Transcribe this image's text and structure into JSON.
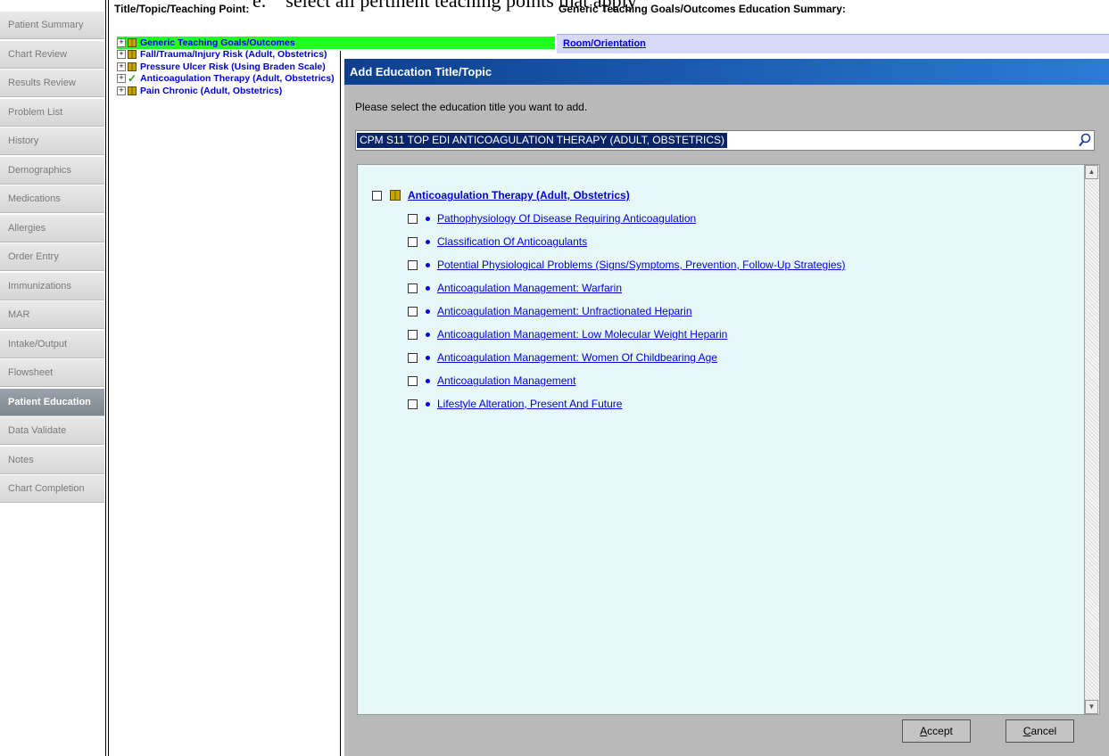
{
  "caption": {
    "marker": "e.",
    "text": "select all pertinent teaching points that apply"
  },
  "nav": {
    "items": [
      {
        "label": "Patient Summary",
        "active": false
      },
      {
        "label": "Chart Review",
        "active": false
      },
      {
        "label": "Results Review",
        "active": false
      },
      {
        "label": "Problem List",
        "active": false
      },
      {
        "label": "History",
        "active": false
      },
      {
        "label": "Demographics",
        "active": false
      },
      {
        "label": "Medications",
        "active": false
      },
      {
        "label": "Allergies",
        "active": false
      },
      {
        "label": "Order Entry",
        "active": false
      },
      {
        "label": "Immunizations",
        "active": false
      },
      {
        "label": "MAR",
        "active": false
      },
      {
        "label": "Intake/Output",
        "active": false
      },
      {
        "label": "Flowsheet",
        "active": false
      },
      {
        "label": "Patient Education",
        "active": true
      },
      {
        "label": "Data Validate",
        "active": false
      },
      {
        "label": "Notes",
        "active": false
      },
      {
        "label": "Chart Completion",
        "active": false
      }
    ]
  },
  "left_header": "Title/Topic/Teaching Point:",
  "right_header": "Generic Teaching Goals/Outcomes Education Summary:",
  "tree": {
    "items": [
      {
        "label": "Generic Teaching Goals/Outcomes",
        "icon": "book-icon",
        "highlighted": true
      },
      {
        "label": "Fall/Trauma/Injury Risk (Adult, Obstetrics)",
        "icon": "book-icon"
      },
      {
        "label": "Pressure Ulcer Risk (Using Braden Scale)",
        "icon": "book-icon"
      },
      {
        "label": "Anticoagulation Therapy (Adult, Obstetrics)",
        "icon": "checkmark-icon"
      },
      {
        "label": "Pain Chronic (Adult, Obstetrics)",
        "icon": "book-icon"
      }
    ]
  },
  "summary": {
    "row_label": "Room/Orientation"
  },
  "dialog": {
    "title": "Add Education Title/Topic",
    "prompt": "Please select the education title you want to add.",
    "search_value": "CPM S11 TOP EDI ANTICOAGULATION THERAPY (ADULT, OBSTETRICS)",
    "topic": "Anticoagulation Therapy (Adult, Obstetrics)",
    "points": [
      "Pathophysiology Of Disease Requiring Anticoagulation",
      "Classification Of Anticoagulants",
      "Potential Physiological Problems (Signs/Symptoms, Prevention, Follow-Up Strategies)",
      "Anticoagulation Management: Warfarin",
      "Anticoagulation Management: Unfractionated Heparin",
      "Anticoagulation Management: Low Molecular Weight Heparin",
      "Anticoagulation Management: Women Of Childbearing Age",
      "Anticoagulation Management",
      "Lifestyle Alteration, Present And Future"
    ],
    "accept": {
      "first": "A",
      "rest": "ccept"
    },
    "cancel": {
      "first": "C",
      "rest": "ancel"
    }
  }
}
